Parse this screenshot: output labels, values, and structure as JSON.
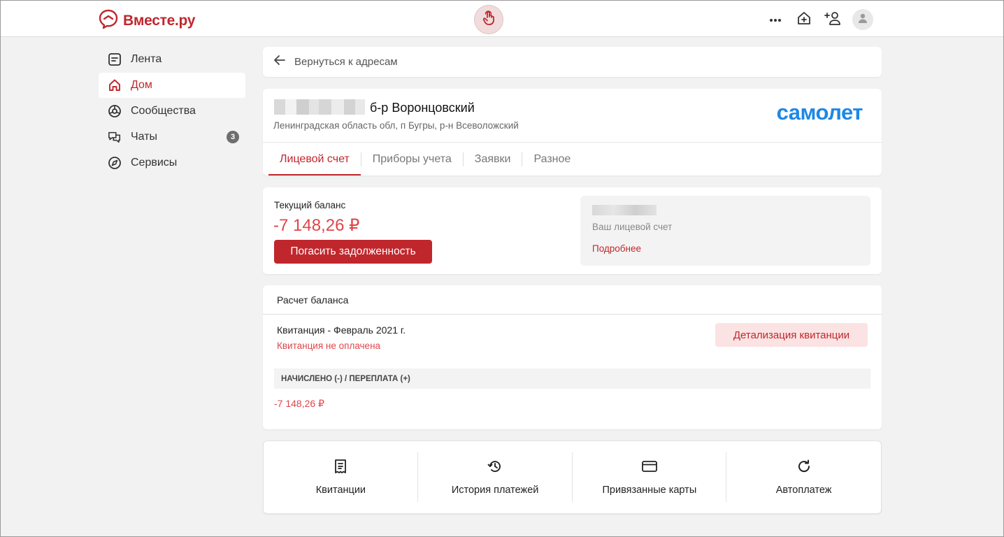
{
  "header": {
    "logo_text": "Вместе.ру",
    "brand_color": "#c0272d",
    "icons": [
      "more-icon",
      "home-plus-icon",
      "add-user-icon",
      "user-avatar-icon"
    ]
  },
  "sidebar": {
    "items": [
      {
        "label": "Лента",
        "icon": "feed-icon"
      },
      {
        "label": "Дом",
        "icon": "house-icon",
        "active": true
      },
      {
        "label": "Сообщества",
        "icon": "communities-icon"
      },
      {
        "label": "Чаты",
        "icon": "chat-icon",
        "badge": "3"
      },
      {
        "label": "Сервисы",
        "icon": "compass-icon"
      }
    ]
  },
  "back": {
    "label": "Вернуться к адресам"
  },
  "address": {
    "street": "б-р Воронцовский",
    "region": "Ленинградская область обл, п Бугры, р-н Всеволожский",
    "company_logo": "самолет",
    "company_color": "#1e88e5"
  },
  "tabs": [
    {
      "label": "Лицевой счет",
      "active": true
    },
    {
      "label": "Приборы учета"
    },
    {
      "label": "Заявки"
    },
    {
      "label": "Разное"
    }
  ],
  "balance": {
    "label": "Текущий баланс",
    "value": "-7 148,26 ₽",
    "pay_button": "Погасить задолженность",
    "account_label": "Ваш лицевой счет",
    "more_link": "Подробнее"
  },
  "calculation": {
    "header": "Расчет баланса",
    "receipt_title": "Квитанция - Февраль 2021 г.",
    "receipt_status": "Квитанция не оплачена",
    "detail_button": "Детализация квитанции",
    "column_header": "НАЧИСЛЕНО (-) / ПЕРЕПЛАТА (+)",
    "amount": "-7 148,26 ₽"
  },
  "actions": [
    {
      "label": "Квитанции",
      "icon": "receipt-icon"
    },
    {
      "label": "История платежей",
      "icon": "history-icon"
    },
    {
      "label": "Привязанные карты",
      "icon": "card-icon"
    },
    {
      "label": "Автоплатеж",
      "icon": "refresh-icon"
    }
  ]
}
